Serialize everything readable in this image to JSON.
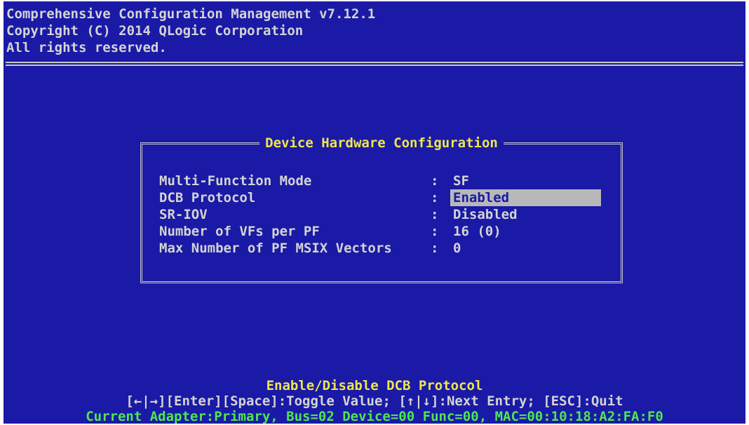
{
  "header": {
    "line1": "Comprehensive Configuration Management v7.12.1",
    "line2": "Copyright (C) 2014 QLogic Corporation",
    "line3": "All rights reserved."
  },
  "dialog": {
    "title": "Device Hardware Configuration",
    "separator": ":",
    "rows": [
      {
        "label": "Multi-Function Mode",
        "value": "SF"
      },
      {
        "label": "DCB Protocol",
        "value": "Enabled",
        "selected": true
      },
      {
        "label": "SR-IOV",
        "value": "Disabled"
      },
      {
        "label": "Number of VFs per PF",
        "value": "16 (0)"
      },
      {
        "label": "Max Number of PF MSIX Vectors",
        "value": "0"
      }
    ]
  },
  "footer": {
    "help": "Enable/Disable DCB Protocol",
    "keys": "[←|→][Enter][Space]:Toggle Value; [↑|↓]:Next Entry; [ESC]:Quit",
    "status": "Current Adapter:Primary, Bus=02 Device=00 Func=00, MAC=00:10:18:A2:FA:F0"
  },
  "colors": {
    "background": "#1a1aa6",
    "title": "#f0e64a",
    "text": "#d4d4d4",
    "status": "#4ee84e",
    "highlight": "#b8b8b8"
  }
}
